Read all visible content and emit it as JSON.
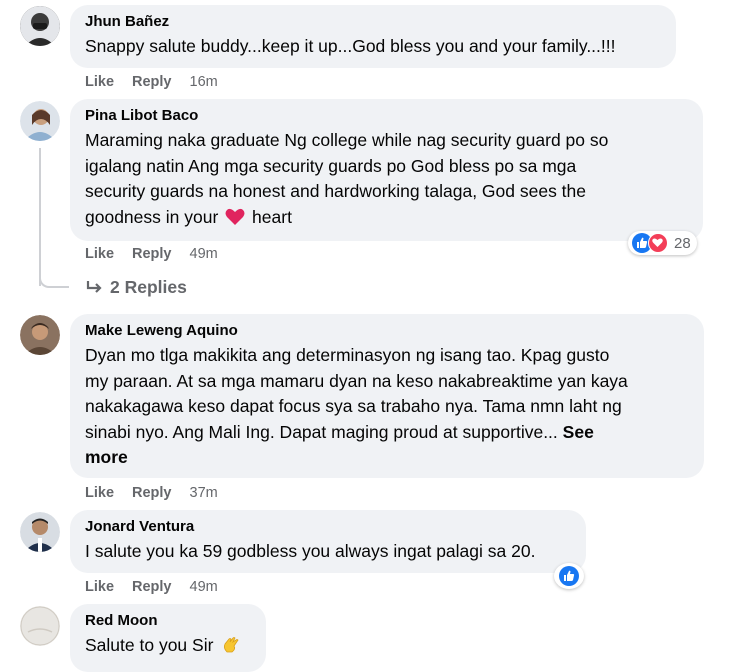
{
  "comments": [
    {
      "author": "Jhun Bañez",
      "text": "Snappy salute buddy...keep it up...God bless you and your family...!!!",
      "like": "Like",
      "reply": "Reply",
      "time": "16m"
    },
    {
      "author": "Pina Libot Baco",
      "line1": "Maraming naka graduate Ng college while nag security guard po so",
      "line2": "igalang natin Ang mga security guards po God bless po sa mga",
      "line3": "security guards na honest and hardworking talaga, God sees the",
      "line4a": "goodness in your",
      "line4b": "heart",
      "like": "Like",
      "reply": "Reply",
      "time": "49m",
      "reaction_count": "28",
      "replies_label": "2 Replies"
    },
    {
      "author": "Make Leweng Aquino",
      "line1": "Dyan mo tlga makikita ang determinasyon ng isang tao. Kpag gusto",
      "line2": "my paraan. At sa mga mamaru dyan na keso nakabreaktime yan kaya",
      "line3": "nakakagawa keso dapat focus sya sa trabaho nya. Tama nmn laht ng",
      "line4": "sinabi nyo. Ang Mali Ing. Dapat maging proud at supportive...",
      "see": "See",
      "more": "more",
      "like": "Like",
      "reply": "Reply",
      "time": "37m"
    },
    {
      "author": "Jonard Ventura",
      "text": "I salute you ka 59 godbless you always ingat palagi sa 20.",
      "like": "Like",
      "reply": "Reply",
      "time": "49m"
    },
    {
      "author": "Red Moon",
      "text": "Salute to you Sir"
    }
  ],
  "colors": {
    "bubble": "#f0f2f5",
    "meta": "#65676b",
    "like_blue": "#1877f2",
    "love_red": "#f33e58"
  },
  "icons": [
    "heart-emoji-icon",
    "like-reaction-icon",
    "love-reaction-icon",
    "reply-arrow-icon",
    "clap-emoji-icon"
  ]
}
